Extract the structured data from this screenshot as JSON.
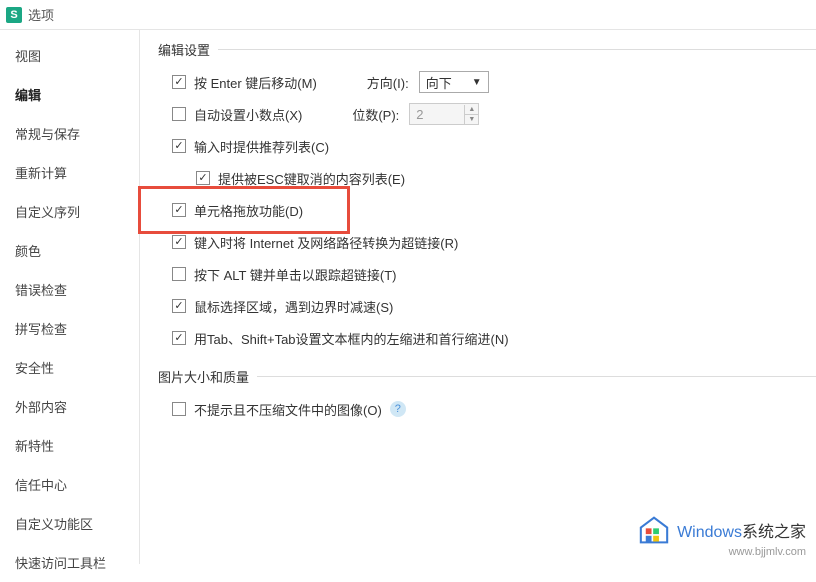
{
  "header": {
    "icon_letter": "S",
    "title": "选项"
  },
  "sidebar": {
    "items": [
      {
        "label": "视图"
      },
      {
        "label": "编辑",
        "active": true
      },
      {
        "label": "常规与保存"
      },
      {
        "label": "重新计算"
      },
      {
        "label": "自定义序列"
      },
      {
        "label": "颜色"
      },
      {
        "label": "错误检查"
      },
      {
        "label": "拼写检查"
      },
      {
        "label": "安全性"
      },
      {
        "label": "外部内容"
      },
      {
        "label": "新特性"
      },
      {
        "label": "信任中心"
      },
      {
        "label": "自定义功能区"
      },
      {
        "label": "快速访问工具栏"
      }
    ]
  },
  "main": {
    "section1_title": "编辑设置",
    "enter_move": {
      "label": "按 Enter 键后移动(M)",
      "checked": true
    },
    "direction": {
      "label": "方向(I):",
      "value": "向下"
    },
    "auto_decimal": {
      "label": "自动设置小数点(X)",
      "checked": false
    },
    "digits": {
      "label": "位数(P):",
      "value": "2"
    },
    "suggest_list": {
      "label": "输入时提供推荐列表(C)",
      "checked": true
    },
    "esc_list": {
      "label": "提供被ESC键取消的内容列表(E)",
      "checked": true
    },
    "drag_drop": {
      "label": "单元格拖放功能(D)",
      "checked": true
    },
    "url_link": {
      "label": "键入时将 Internet 及网络路径转换为超链接(R)",
      "checked": true
    },
    "alt_click": {
      "label": "按下 ALT 键并单击以跟踪超链接(T)",
      "checked": false
    },
    "mouse_select": {
      "label": "鼠标选择区域，遇到边界时减速(S)",
      "checked": true
    },
    "tab_indent": {
      "label": "用Tab、Shift+Tab设置文本框内的左缩进和首行缩进(N)",
      "checked": true
    },
    "section2_title": "图片大小和质量",
    "no_compress": {
      "label": "不提示且不压缩文件中的图像(O)",
      "checked": false
    }
  },
  "watermark": {
    "brand": "Windows",
    "suffix": "系统之家",
    "url": "www.bjjmlv.com"
  }
}
